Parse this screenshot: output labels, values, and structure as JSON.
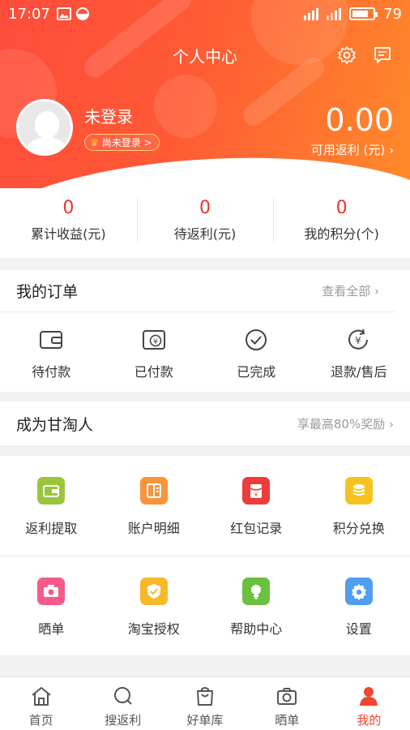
{
  "status_bar": {
    "time": "17:07",
    "battery": "79"
  },
  "header": {
    "title": "个人中心"
  },
  "profile": {
    "name": "未登录",
    "login_badge": "尚未登录 >"
  },
  "rebate": {
    "amount": "0.00",
    "label": "可用返利 (元)  ›"
  },
  "stats": [
    {
      "value": "0",
      "label": "累计收益(元)"
    },
    {
      "value": "0",
      "label": "待返利(元)"
    },
    {
      "value": "0",
      "label": "我的积分(个)"
    }
  ],
  "orders": {
    "title": "我的订单",
    "more": "查看全部 ›",
    "items": [
      {
        "label": "待付款",
        "icon": "wallet-icon"
      },
      {
        "label": "已付款",
        "icon": "yen-receipt-icon"
      },
      {
        "label": "已完成",
        "icon": "check-circle-icon"
      },
      {
        "label": "退款/售后",
        "icon": "yen-refund-icon"
      }
    ]
  },
  "taoren": {
    "title": "成为甘淘人",
    "more": "享最高80%奖励 ›"
  },
  "tools": [
    {
      "label": "返利提取",
      "icon": "withdraw-wallet-icon",
      "color": "#9bc53d"
    },
    {
      "label": "账户明细",
      "icon": "account-detail-icon",
      "color": "#f7943c"
    },
    {
      "label": "红包记录",
      "icon": "red-envelope-icon",
      "color": "#ee3b3b"
    },
    {
      "label": "积分兑换",
      "icon": "coins-icon",
      "color": "#f5c31e"
    },
    {
      "label": "晒单",
      "icon": "camera-icon",
      "color": "#f45a8a"
    },
    {
      "label": "淘宝授权",
      "icon": "shield-check-icon",
      "color": "#f5b92a"
    },
    {
      "label": "帮助中心",
      "icon": "lightbulb-icon",
      "color": "#6ac13f"
    },
    {
      "label": "设置",
      "icon": "gear-icon",
      "color": "#4f9ef0"
    }
  ],
  "nav": [
    {
      "label": "首页",
      "icon": "home-icon"
    },
    {
      "label": "搜返利",
      "icon": "search-icon"
    },
    {
      "label": "好单库",
      "icon": "shopping-bag-icon"
    },
    {
      "label": "晒单",
      "icon": "camera-icon"
    },
    {
      "label": "我的",
      "icon": "user-icon",
      "active": true
    }
  ],
  "colors": {
    "accent": "#f0452e",
    "value_red": "#e8362b"
  }
}
